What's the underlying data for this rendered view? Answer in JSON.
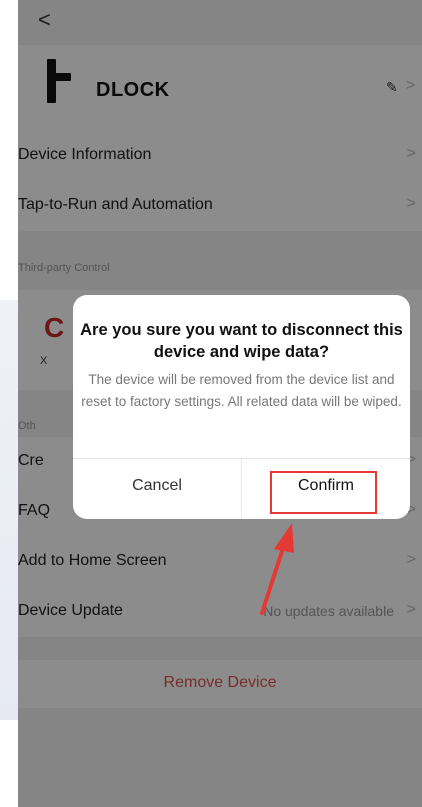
{
  "nav": {
    "back_glyph": "<"
  },
  "device": {
    "name": "DLOCK",
    "edit_glyph": "✎",
    "chevron": ">"
  },
  "rows_top": [
    {
      "label": "Device Information",
      "chevron": ">"
    },
    {
      "label": "Tap-to-Run and Automation",
      "chevron": ">"
    }
  ],
  "third_party": {
    "header": "Third-party Control",
    "item_icon_glyph": "C",
    "item_label_partial": "X"
  },
  "others": {
    "header_partial": "Oth",
    "rows": [
      {
        "label_partial": "Cre",
        "chevron": ">"
      },
      {
        "label_partial": "FAQ",
        "chevron": ">"
      },
      {
        "label": "Add to Home Screen",
        "chevron": ">"
      },
      {
        "label": "Device Update",
        "value": "No updates available",
        "chevron": ">"
      }
    ]
  },
  "remove": {
    "label": "Remove Device",
    "color": "#d9534f"
  },
  "dialog": {
    "title": "Are you sure you want to disconnect this device and wipe data?",
    "message": "The device will be removed from the device list and reset to factory settings. All related data will be wiped.",
    "cancel_label": "Cancel",
    "confirm_label": "Confirm",
    "highlight_color": "#e53935"
  }
}
